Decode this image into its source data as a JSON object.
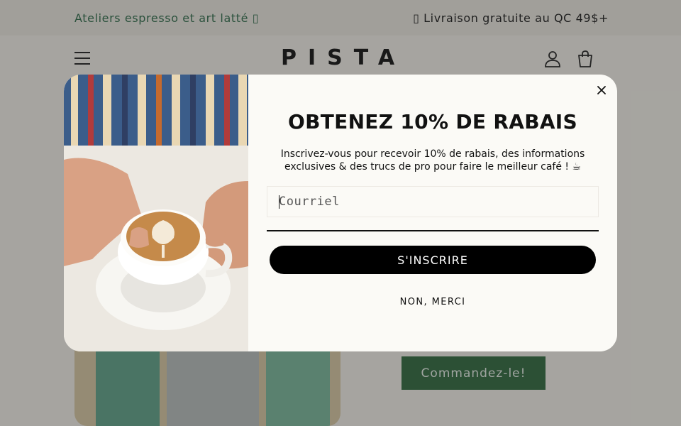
{
  "announcement": {
    "left": "Ateliers espresso et art latté ▯",
    "right": "▯ Livraison gratuite au QC 49$+"
  },
  "header": {
    "logo": "PISTA",
    "icons": [
      "menu-icon",
      "account-icon",
      "cart-icon"
    ]
  },
  "page": {
    "order_button": "Commandez-le!"
  },
  "popup": {
    "title": "OBTENEZ 10% DE RABAIS",
    "subtitle": "Inscrivez-vous pour recevoir 10% de rabais, des informations exclusives & des trucs de pro pour faire le meilleur café ! ☕",
    "email_placeholder": "Courriel",
    "email_value": "",
    "subscribe_label": "S'INSCRIRE",
    "decline_label": "NON, MERCI"
  },
  "colors": {
    "brand_green": "#2f6a3e",
    "announce_green": "#2e6b4a",
    "button_black": "#000000"
  }
}
